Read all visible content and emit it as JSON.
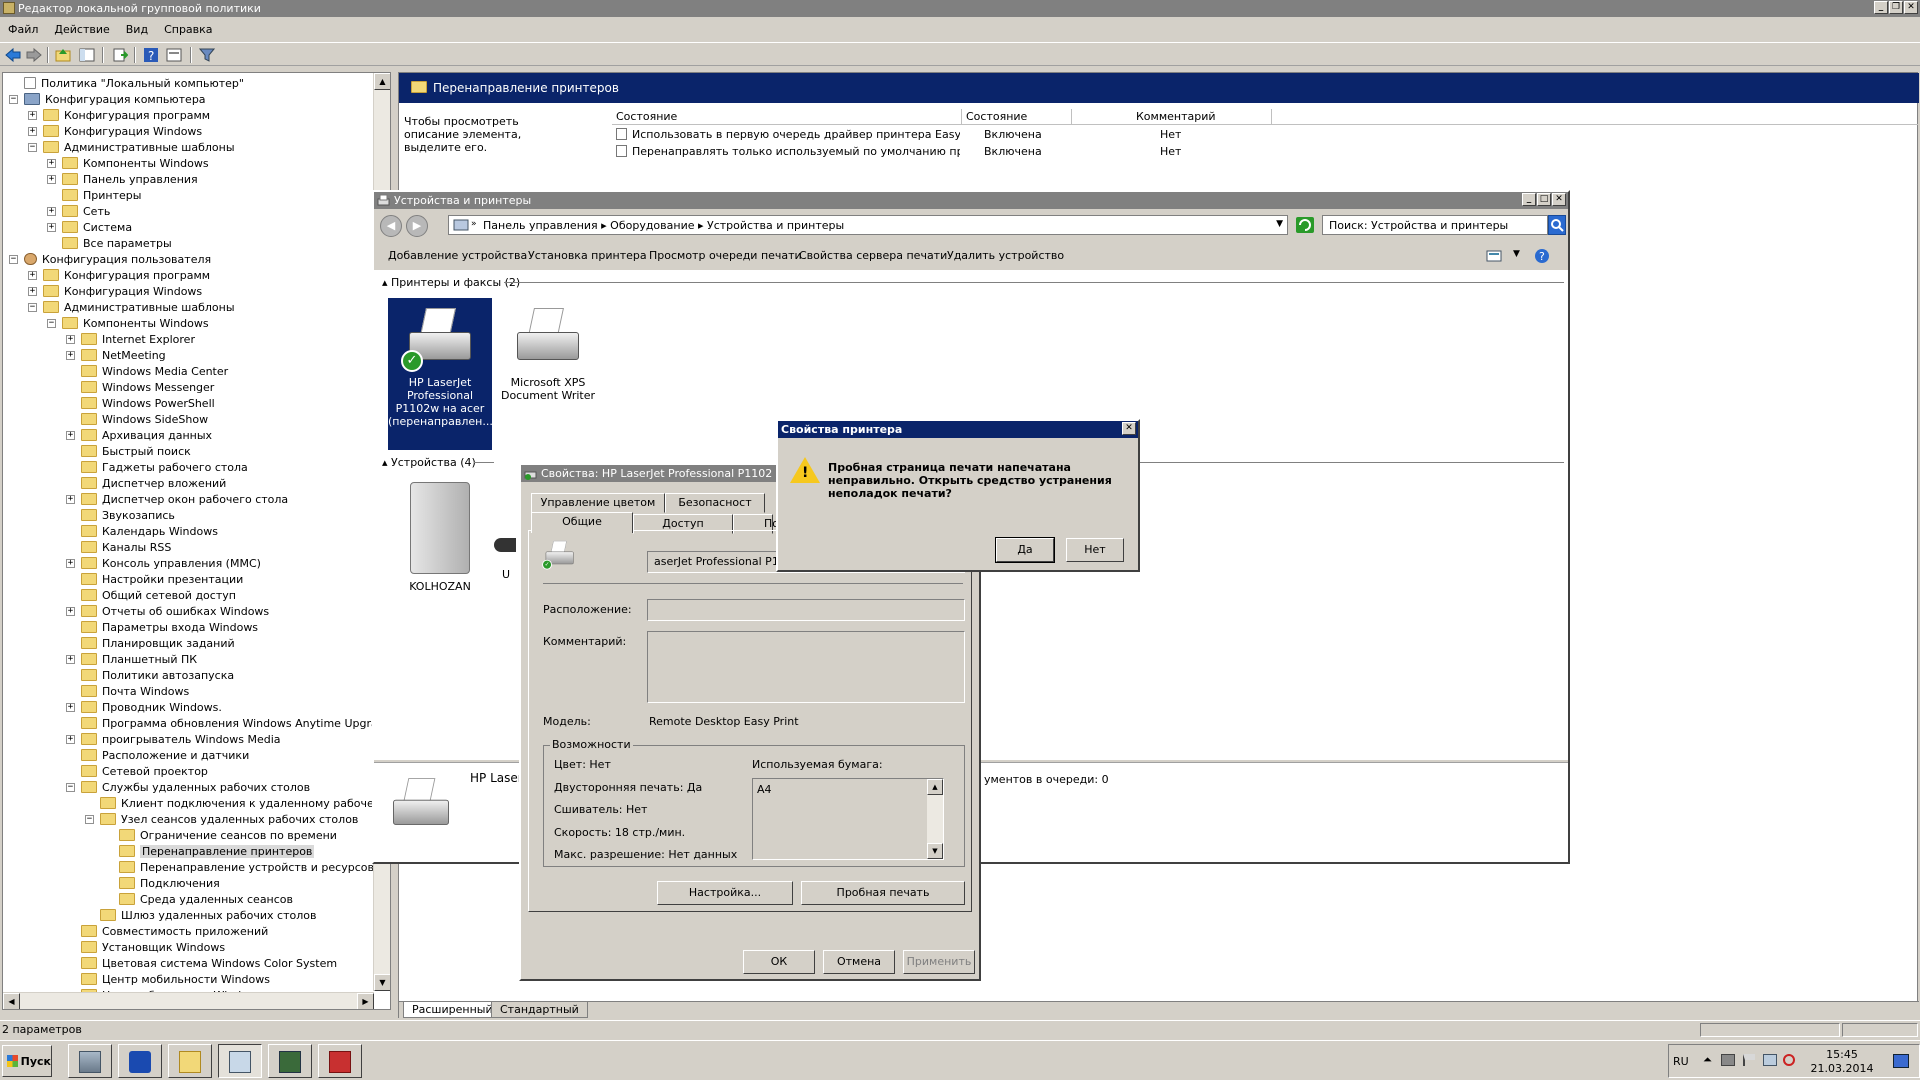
{
  "main_window": {
    "title": "Редактор локальной групповой политики",
    "menu": [
      "Файл",
      "Действие",
      "Вид",
      "Справка"
    ]
  },
  "tree": [
    {
      "label": "Политика \"Локальный компьютер\"",
      "level": 0,
      "toggle": "",
      "icon": "doc"
    },
    {
      "label": "Конфигурация компьютера",
      "level": 0,
      "toggle": "-",
      "icon": "pc"
    },
    {
      "label": "Конфигурация программ",
      "level": 1,
      "toggle": "+",
      "icon": "folder"
    },
    {
      "label": "Конфигурация Windows",
      "level": 1,
      "toggle": "+",
      "icon": "folder"
    },
    {
      "label": "Административные шаблоны",
      "level": 1,
      "toggle": "-",
      "icon": "folder"
    },
    {
      "label": "Компоненты Windows",
      "level": 2,
      "toggle": "+",
      "icon": "folder"
    },
    {
      "label": "Панель управления",
      "level": 2,
      "toggle": "+",
      "icon": "folder"
    },
    {
      "label": "Принтеры",
      "level": 2,
      "toggle": "",
      "icon": "folder"
    },
    {
      "label": "Сеть",
      "level": 2,
      "toggle": "+",
      "icon": "folder"
    },
    {
      "label": "Система",
      "level": 2,
      "toggle": "+",
      "icon": "folder"
    },
    {
      "label": "Все параметры",
      "level": 2,
      "toggle": "",
      "icon": "folder"
    },
    {
      "label": "Конфигурация пользователя",
      "level": 0,
      "toggle": "-",
      "icon": "user"
    },
    {
      "label": "Конфигурация программ",
      "level": 1,
      "toggle": "+",
      "icon": "folder"
    },
    {
      "label": "Конфигурация Windows",
      "level": 1,
      "toggle": "+",
      "icon": "folder"
    },
    {
      "label": "Административные шаблоны",
      "level": 1,
      "toggle": "-",
      "icon": "folder"
    },
    {
      "label": "Компоненты Windows",
      "level": 2,
      "toggle": "-",
      "icon": "folder"
    },
    {
      "label": "Internet Explorer",
      "level": 3,
      "toggle": "+",
      "icon": "folder"
    },
    {
      "label": "NetMeeting",
      "level": 3,
      "toggle": "+",
      "icon": "folder"
    },
    {
      "label": "Windows Media Center",
      "level": 3,
      "toggle": "",
      "icon": "folder"
    },
    {
      "label": "Windows Messenger",
      "level": 3,
      "toggle": "",
      "icon": "folder"
    },
    {
      "label": "Windows PowerShell",
      "level": 3,
      "toggle": "",
      "icon": "folder"
    },
    {
      "label": "Windows SideShow",
      "level": 3,
      "toggle": "",
      "icon": "folder"
    },
    {
      "label": "Архивация данных",
      "level": 3,
      "toggle": "+",
      "icon": "folder"
    },
    {
      "label": "Быстрый поиск",
      "level": 3,
      "toggle": "",
      "icon": "folder"
    },
    {
      "label": "Гаджеты рабочего стола",
      "level": 3,
      "toggle": "",
      "icon": "folder"
    },
    {
      "label": "Диспетчер вложений",
      "level": 3,
      "toggle": "",
      "icon": "folder"
    },
    {
      "label": "Диспетчер окон рабочего стола",
      "level": 3,
      "toggle": "+",
      "icon": "folder"
    },
    {
      "label": "Звукозапись",
      "level": 3,
      "toggle": "",
      "icon": "folder"
    },
    {
      "label": "Календарь Windows",
      "level": 3,
      "toggle": "",
      "icon": "folder"
    },
    {
      "label": "Каналы RSS",
      "level": 3,
      "toggle": "",
      "icon": "folder"
    },
    {
      "label": "Консоль управления (MMC)",
      "level": 3,
      "toggle": "+",
      "icon": "folder"
    },
    {
      "label": "Настройки презентации",
      "level": 3,
      "toggle": "",
      "icon": "folder"
    },
    {
      "label": "Общий сетевой доступ",
      "level": 3,
      "toggle": "",
      "icon": "folder"
    },
    {
      "label": "Отчеты об ошибках Windows",
      "level": 3,
      "toggle": "+",
      "icon": "folder"
    },
    {
      "label": "Параметры входа Windows",
      "level": 3,
      "toggle": "",
      "icon": "folder"
    },
    {
      "label": "Планировщик заданий",
      "level": 3,
      "toggle": "",
      "icon": "folder"
    },
    {
      "label": "Планшетный ПК",
      "level": 3,
      "toggle": "+",
      "icon": "folder"
    },
    {
      "label": "Политики автозапуска",
      "level": 3,
      "toggle": "",
      "icon": "folder"
    },
    {
      "label": "Почта Windows",
      "level": 3,
      "toggle": "",
      "icon": "folder"
    },
    {
      "label": "Проводник Windows.",
      "level": 3,
      "toggle": "+",
      "icon": "folder"
    },
    {
      "label": "Программа обновления Windows Anytime Upgrade",
      "level": 3,
      "toggle": "",
      "icon": "folder"
    },
    {
      "label": "проигрыватель Windows Media",
      "level": 3,
      "toggle": "+",
      "icon": "folder"
    },
    {
      "label": "Расположение и датчики",
      "level": 3,
      "toggle": "",
      "icon": "folder"
    },
    {
      "label": "Сетевой проектор",
      "level": 3,
      "toggle": "",
      "icon": "folder"
    },
    {
      "label": "Службы удаленных рабочих столов",
      "level": 3,
      "toggle": "-",
      "icon": "folder"
    },
    {
      "label": "Клиент подключения к удаленному рабочему сто",
      "level": 4,
      "toggle": "",
      "icon": "folder"
    },
    {
      "label": "Узел сеансов удаленных рабочих столов",
      "level": 4,
      "toggle": "-",
      "icon": "folder"
    },
    {
      "label": "Ограничение сеансов по времени",
      "level": 5,
      "toggle": "",
      "icon": "folder"
    },
    {
      "label": "Перенаправление принтеров",
      "level": 5,
      "toggle": "",
      "icon": "folder",
      "selected": true
    },
    {
      "label": "Перенаправление устройств и ресурсов",
      "level": 5,
      "toggle": "",
      "icon": "folder"
    },
    {
      "label": "Подключения",
      "level": 5,
      "toggle": "",
      "icon": "folder"
    },
    {
      "label": "Среда удаленных сеансов",
      "level": 5,
      "toggle": "",
      "icon": "folder"
    },
    {
      "label": "Шлюз удаленных рабочих столов",
      "level": 4,
      "toggle": "",
      "icon": "folder"
    },
    {
      "label": "Совместимость приложений",
      "level": 3,
      "toggle": "",
      "icon": "folder"
    },
    {
      "label": "Установщик Windows",
      "level": 3,
      "toggle": "",
      "icon": "folder"
    },
    {
      "label": "Цветовая система Windows Color System",
      "level": 3,
      "toggle": "",
      "icon": "folder"
    },
    {
      "label": "Центр мобильности Windows",
      "level": 3,
      "toggle": "",
      "icon": "folder"
    },
    {
      "label": "Центр обновления Windows",
      "level": 3,
      "toggle": "",
      "icon": "folder"
    }
  ],
  "right_pane": {
    "header": "Перенаправление принтеров",
    "description": "Чтобы просмотреть описание элемента, выделите его.",
    "columns": [
      "Состояние",
      "Состояние",
      "Комментарий"
    ],
    "rows": [
      {
        "name": "Использовать в первую очередь драйвер принтера Easy Prin...",
        "state": "Включена",
        "comment": "Нет"
      },
      {
        "name": "Перенаправлять только используемый по умолчанию принте...",
        "state": "Включена",
        "comment": "Нет"
      }
    ],
    "tabs": [
      "Расширенный",
      "Стандартный"
    ]
  },
  "statusbar": {
    "text": "2 параметров"
  },
  "devices_window": {
    "title": "Устройства и принтеры",
    "breadcrumbs": "Панель управления  ▸  Оборудование  ▸  Устройства и принтеры",
    "search": "Поиск: Устройства и принтеры",
    "commands": [
      "Добавление устройства",
      "Установка принтера",
      "Просмотр очереди печати",
      "Свойства сервера печати",
      "Удалить устройство"
    ],
    "group_printers": "Принтеры и факсы (2)",
    "group_devices": "Устройства (4)",
    "printers": [
      {
        "label": "HP LaserJet Professional P1102w на acer (перенаправлен...",
        "selected": true
      },
      {
        "label": "Microsoft XPS Document Writer",
        "selected": false
      }
    ],
    "devices": [
      {
        "label": "KOLHOZAN"
      },
      {
        "label": "U"
      }
    ],
    "detail_name": "HP Laser",
    "detail_queue": "ументов в очереди: 0"
  },
  "printer_props": {
    "title": "Свойства: HP LaserJet Professional P1102",
    "tabs_back": [
      "Управление цветом",
      "Безопасност"
    ],
    "tabs_front": [
      "Общие",
      "Доступ",
      "По"
    ],
    "name_value": "aserJet Professional P1",
    "location_label": "Расположение:",
    "comment_label": "Комментарий:",
    "model_label": "Модель:",
    "model_value": "Remote Desktop Easy Print",
    "features_legend": "Возможности",
    "color": "Цвет: Нет",
    "duplex": "Двусторонняя печать: Да",
    "staple": "Сшиватель: Нет",
    "speed": "Скорость: 18 стр./мин.",
    "resolution": "Макс. разрешение: Нет данных",
    "paper_label": "Используемая бумага:",
    "paper": "A4",
    "settings_btn": "Настройка...",
    "test_btn": "Пробная печать",
    "ok_btn": "ОК",
    "cancel_btn": "Отмена",
    "apply_btn": "Применить"
  },
  "message_box": {
    "title": "Свойства принтера",
    "text": "Пробная страница печати напечатана неправильно. Открыть средство устранения неполадок печати?",
    "yes": "Да",
    "no": "Нет"
  },
  "taskbar": {
    "start": "Пуск",
    "lang": "RU",
    "time": "15:45",
    "date": "21.03.2014"
  },
  "colors": {
    "title_active": "#0a246a",
    "title_inactive": "#808080",
    "face": "#d4d0c8"
  }
}
